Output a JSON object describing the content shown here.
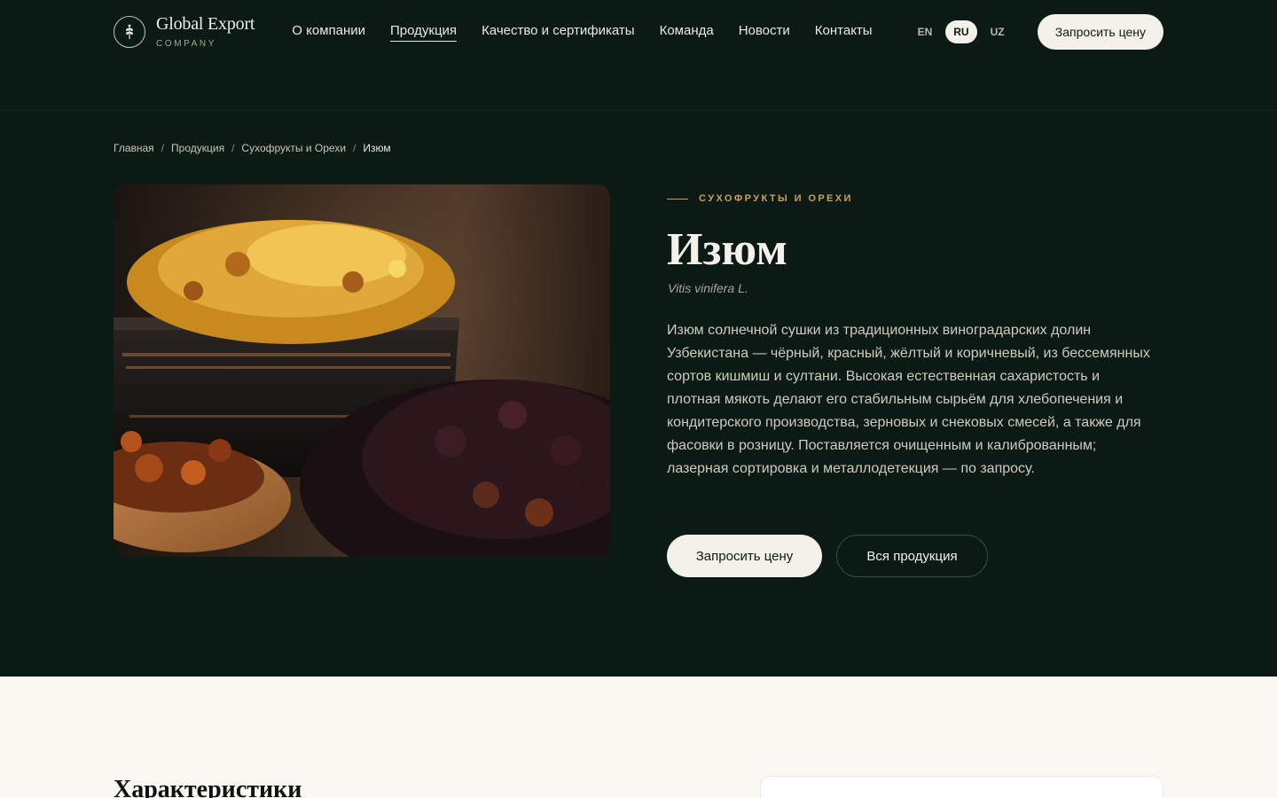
{
  "header": {
    "brand_name": "Global Export",
    "brand_sub": "COMPANY",
    "nav": [
      {
        "label": "О компании"
      },
      {
        "label": "Продукция",
        "active": true
      },
      {
        "label": "Качество и сертификаты"
      },
      {
        "label": "Команда"
      },
      {
        "label": "Новости"
      },
      {
        "label": "Контакты"
      }
    ],
    "langs": [
      {
        "label": "EN"
      },
      {
        "label": "RU",
        "active": true
      },
      {
        "label": "UZ"
      }
    ],
    "cta_label": "Запросить цену"
  },
  "breadcrumb": {
    "items": [
      "Главная",
      "Продукция",
      "Сухофрукты и Орехи",
      "Изюм"
    ],
    "separator": "/"
  },
  "product": {
    "category": "СУХОФРУКТЫ И ОРЕХИ",
    "title": "Изюм",
    "latin": "Vitis vinifera L.",
    "description": "Изюм солнечной сушки из традиционных виноградарских долин Узбекистана — чёрный, красный, жёлтый и коричневый, из бессемянных сортов кишмиш и султани. Высокая естественная сахаристость и плотная мякоть делают его стабильным сырьём для хлебопечения и кондитерского производства, зерновых и снековых смесей, а также для фасовки в розницу. Поставляется очищенным и калиброванным; лазерная сортировка и металлодетекция — по запросу.",
    "primary_button": "Запросить цену",
    "secondary_button": "Вся продукция"
  },
  "specs": {
    "title": "Характеристики"
  },
  "colors": {
    "hero_bg": "#0b1a15",
    "accent": "#c8a15a",
    "light_bg": "#faf8f3"
  }
}
